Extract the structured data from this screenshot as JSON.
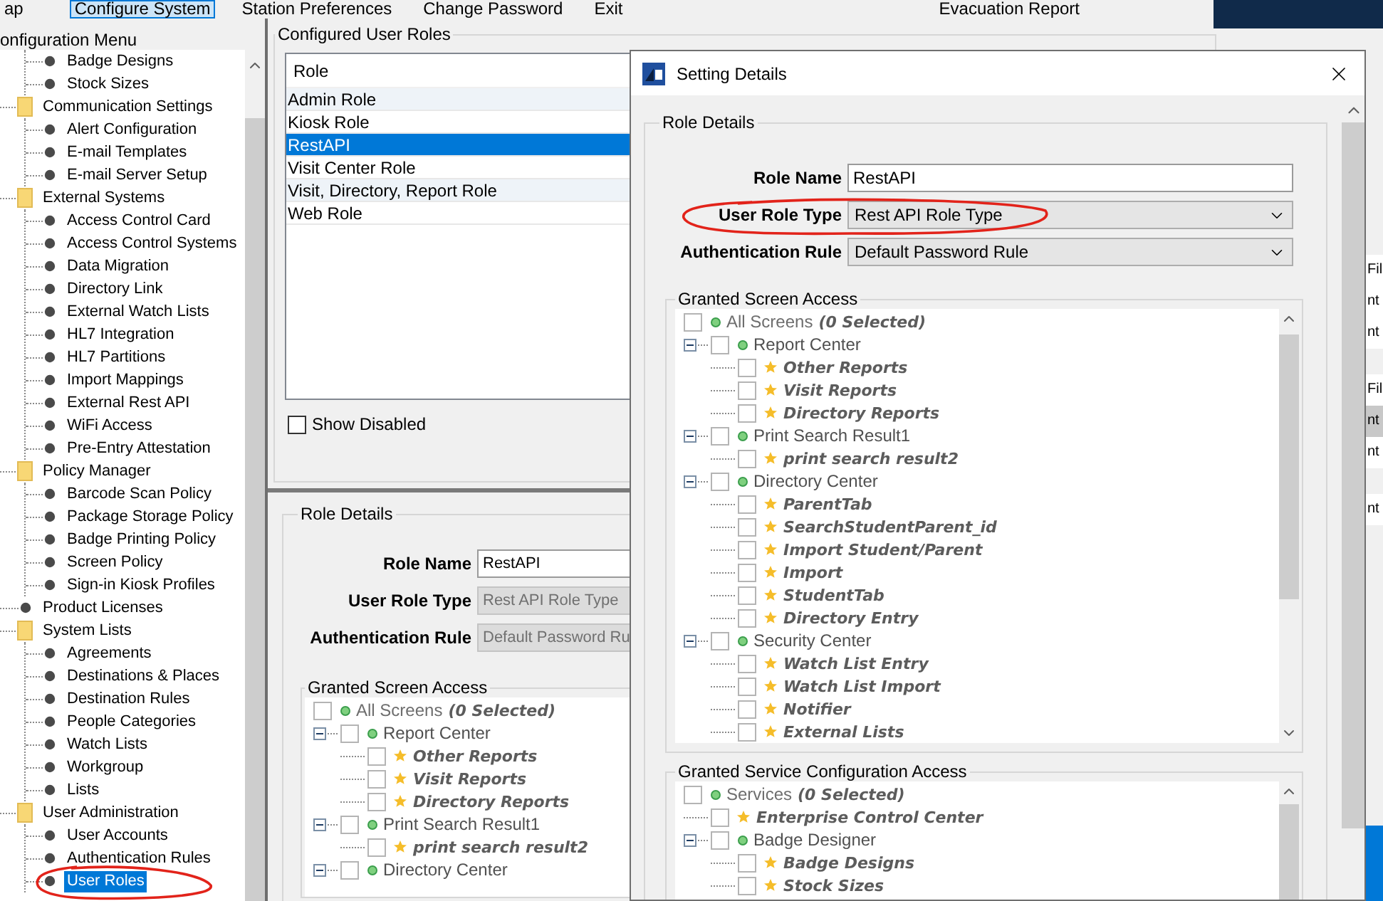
{
  "menu_bar": {
    "items": [
      {
        "label": "ap",
        "selected": false
      },
      {
        "label": "Configure System",
        "selected": true
      },
      {
        "label": "Station Preferences",
        "selected": false
      },
      {
        "label": "Change Password",
        "selected": false
      },
      {
        "label": "Exit",
        "selected": false
      },
      {
        "label": "Evacuation Report",
        "selected": false
      }
    ]
  },
  "config_menu": {
    "title": "onfiguration Menu",
    "tree": [
      {
        "kind": "continued",
        "children": [
          {
            "kind": "leaf",
            "label": "Badge Designs",
            "selected": false
          },
          {
            "kind": "leaf",
            "label": "Stock Sizes",
            "selected": false
          }
        ]
      },
      {
        "kind": "folder",
        "label": "Communication Settings",
        "expanded": true,
        "children": [
          {
            "kind": "leaf",
            "label": "Alert Configuration",
            "selected": false
          },
          {
            "kind": "leaf",
            "label": "E-mail Templates",
            "selected": false
          },
          {
            "kind": "leaf",
            "label": "E-mail Server Setup",
            "selected": false
          }
        ]
      },
      {
        "kind": "folder",
        "label": "External Systems",
        "expanded": true,
        "children": [
          {
            "kind": "leaf",
            "label": "Access Control Card",
            "selected": false
          },
          {
            "kind": "leaf",
            "label": "Access Control Systems",
            "selected": false
          },
          {
            "kind": "leaf",
            "label": "Data Migration",
            "selected": false
          },
          {
            "kind": "leaf",
            "label": "Directory Link",
            "selected": false
          },
          {
            "kind": "leaf",
            "label": "External Watch Lists",
            "selected": false
          },
          {
            "kind": "leaf",
            "label": "HL7 Integration",
            "selected": false
          },
          {
            "kind": "leaf",
            "label": "HL7 Partitions",
            "selected": false
          },
          {
            "kind": "leaf",
            "label": "Import Mappings",
            "selected": false
          },
          {
            "kind": "leaf",
            "label": "External Rest API",
            "selected": false
          },
          {
            "kind": "leaf",
            "label": "WiFi Access",
            "selected": false
          },
          {
            "kind": "leaf",
            "label": "Pre-Entry Attestation",
            "selected": false
          }
        ]
      },
      {
        "kind": "folder",
        "label": "Policy Manager",
        "expanded": true,
        "children": [
          {
            "kind": "leaf",
            "label": "Barcode Scan Policy",
            "selected": false
          },
          {
            "kind": "leaf",
            "label": "Package Storage Policy",
            "selected": false
          },
          {
            "kind": "leaf",
            "label": "Badge Printing Policy",
            "selected": false
          },
          {
            "kind": "leaf",
            "label": "Screen Policy",
            "selected": false
          },
          {
            "kind": "leaf",
            "label": "Sign-in Kiosk Profiles",
            "selected": false
          }
        ]
      },
      {
        "kind": "leaf",
        "label": "Product Licenses",
        "selected": false
      },
      {
        "kind": "folder",
        "label": "System Lists",
        "expanded": true,
        "children": [
          {
            "kind": "leaf",
            "label": "Agreements",
            "selected": false
          },
          {
            "kind": "leaf",
            "label": "Destinations & Places",
            "selected": false
          },
          {
            "kind": "leaf",
            "label": "Destination Rules",
            "selected": false
          },
          {
            "kind": "leaf",
            "label": "People Categories",
            "selected": false
          },
          {
            "kind": "leaf",
            "label": "Watch Lists",
            "selected": false
          },
          {
            "kind": "leaf",
            "label": "Workgroup",
            "selected": false
          },
          {
            "kind": "leaf",
            "label": "Lists",
            "selected": false
          }
        ]
      },
      {
        "kind": "folder",
        "label": "User Administration",
        "expanded": true,
        "children": [
          {
            "kind": "leaf",
            "label": "User Accounts",
            "selected": false
          },
          {
            "kind": "leaf",
            "label": "Authentication Rules",
            "selected": false
          },
          {
            "kind": "leaf",
            "label": "User Roles",
            "selected": true
          }
        ]
      }
    ]
  },
  "configured_roles": {
    "title": "Configured User Roles",
    "column": "Role",
    "rows": [
      {
        "label": "Admin Role",
        "selected": false
      },
      {
        "label": "Kiosk Role",
        "selected": false
      },
      {
        "label": "RestAPI",
        "selected": true
      },
      {
        "label": "Visit Center Role",
        "selected": false
      },
      {
        "label": "Visit, Directory, Report Role",
        "selected": false
      },
      {
        "label": "Web Role",
        "selected": false
      }
    ],
    "show_disabled": {
      "label": "Show Disabled",
      "checked": false
    }
  },
  "role_details": {
    "title": "Role Details",
    "fields": [
      {
        "label": "Role Name",
        "value": "RestAPI",
        "kind": "text",
        "disabled": false
      },
      {
        "label": "User Role Type",
        "value": "Rest API Role Type",
        "kind": "text",
        "disabled": true
      },
      {
        "label": "Authentication Rule",
        "value": "Default Password Ru",
        "kind": "text",
        "disabled": true
      }
    ],
    "screen_access": {
      "title": "Granted Screen Access",
      "tree": [
        {
          "kind": "root",
          "label": "All Screens",
          "count": "(0 Selected)",
          "checked": false,
          "children": [
            {
              "kind": "group",
              "label": "Report Center",
              "checked": false,
              "expanded": true,
              "children": [
                {
                  "kind": "item",
                  "label": "Other Reports",
                  "checked": false
                },
                {
                  "kind": "item",
                  "label": "Visit Reports",
                  "checked": false
                },
                {
                  "kind": "item",
                  "label": "Directory Reports",
                  "checked": false
                }
              ]
            },
            {
              "kind": "group",
              "label": "Print Search Result1",
              "checked": false,
              "expanded": true,
              "children": [
                {
                  "kind": "item",
                  "label": "print search result2",
                  "checked": false
                }
              ]
            },
            {
              "kind": "group",
              "label": "Directory Center",
              "checked": false,
              "expanded": true
            }
          ]
        }
      ]
    }
  },
  "right_fragments": [
    [
      {
        "label": "Fil",
        "selected": false
      },
      {
        "label": "nt",
        "selected": false
      },
      {
        "label": "nt",
        "selected": false
      }
    ],
    [
      {
        "label": "Fil",
        "selected": false
      },
      {
        "label": "nt",
        "selected": true
      },
      {
        "label": "nt",
        "selected": false
      }
    ],
    [
      {
        "label": "nt",
        "selected": false
      }
    ]
  ],
  "dialog": {
    "title": "Setting Details",
    "role_details": {
      "title": "Role Details",
      "fields": [
        {
          "label": "Role Name",
          "value": "RestAPI",
          "kind": "text",
          "disabled": false
        },
        {
          "label": "User Role Type",
          "value": "Rest API Role Type",
          "kind": "select",
          "disabled": false
        },
        {
          "label": "Authentication Rule",
          "value": "Default Password Rule",
          "kind": "select",
          "disabled": false
        }
      ]
    },
    "screen_access": {
      "title": "Granted Screen Access",
      "tree": [
        {
          "kind": "root",
          "label": "All Screens",
          "count": "(0 Selected)",
          "checked": false,
          "children": [
            {
              "kind": "group",
              "label": "Report Center",
              "checked": false,
              "expanded": true,
              "children": [
                {
                  "kind": "item",
                  "label": "Other Reports",
                  "checked": false
                },
                {
                  "kind": "item",
                  "label": "Visit Reports",
                  "checked": false
                },
                {
                  "kind": "item",
                  "label": "Directory Reports",
                  "checked": false
                }
              ]
            },
            {
              "kind": "group",
              "label": "Print Search Result1",
              "checked": false,
              "expanded": true,
              "children": [
                {
                  "kind": "item",
                  "label": "print search result2",
                  "checked": false
                }
              ]
            },
            {
              "kind": "group",
              "label": "Directory Center",
              "checked": false,
              "expanded": true,
              "children": [
                {
                  "kind": "item",
                  "label": "ParentTab",
                  "checked": false
                },
                {
                  "kind": "item",
                  "label": "SearchStudentParent_id",
                  "checked": false
                },
                {
                  "kind": "item",
                  "label": "Import Student/Parent",
                  "checked": false
                },
                {
                  "kind": "item",
                  "label": "Import",
                  "checked": false
                },
                {
                  "kind": "item",
                  "label": "StudentTab",
                  "checked": false
                },
                {
                  "kind": "item",
                  "label": "Directory Entry",
                  "checked": false
                }
              ]
            },
            {
              "kind": "group",
              "label": "Security Center",
              "checked": false,
              "expanded": true,
              "children": [
                {
                  "kind": "item",
                  "label": "Watch List Entry",
                  "checked": false
                },
                {
                  "kind": "item",
                  "label": "Watch List Import",
                  "checked": false
                },
                {
                  "kind": "item",
                  "label": "Notifier",
                  "checked": false
                },
                {
                  "kind": "item",
                  "label": "External Lists",
                  "checked": false
                }
              ]
            }
          ]
        }
      ]
    },
    "service_access": {
      "title": "Granted Service Configuration Access",
      "tree": [
        {
          "kind": "root",
          "label": "Services",
          "count": "(0 Selected)",
          "checked": false,
          "children": [
            {
              "kind": "item",
              "label": "Enterprise Control Center",
              "checked": false
            },
            {
              "kind": "group",
              "label": "Badge Designer",
              "checked": false,
              "expanded": true,
              "children": [
                {
                  "kind": "item",
                  "label": "Badge Designs",
                  "checked": false
                },
                {
                  "kind": "item",
                  "label": "Stock Sizes",
                  "checked": false
                }
              ]
            }
          ]
        }
      ]
    }
  }
}
